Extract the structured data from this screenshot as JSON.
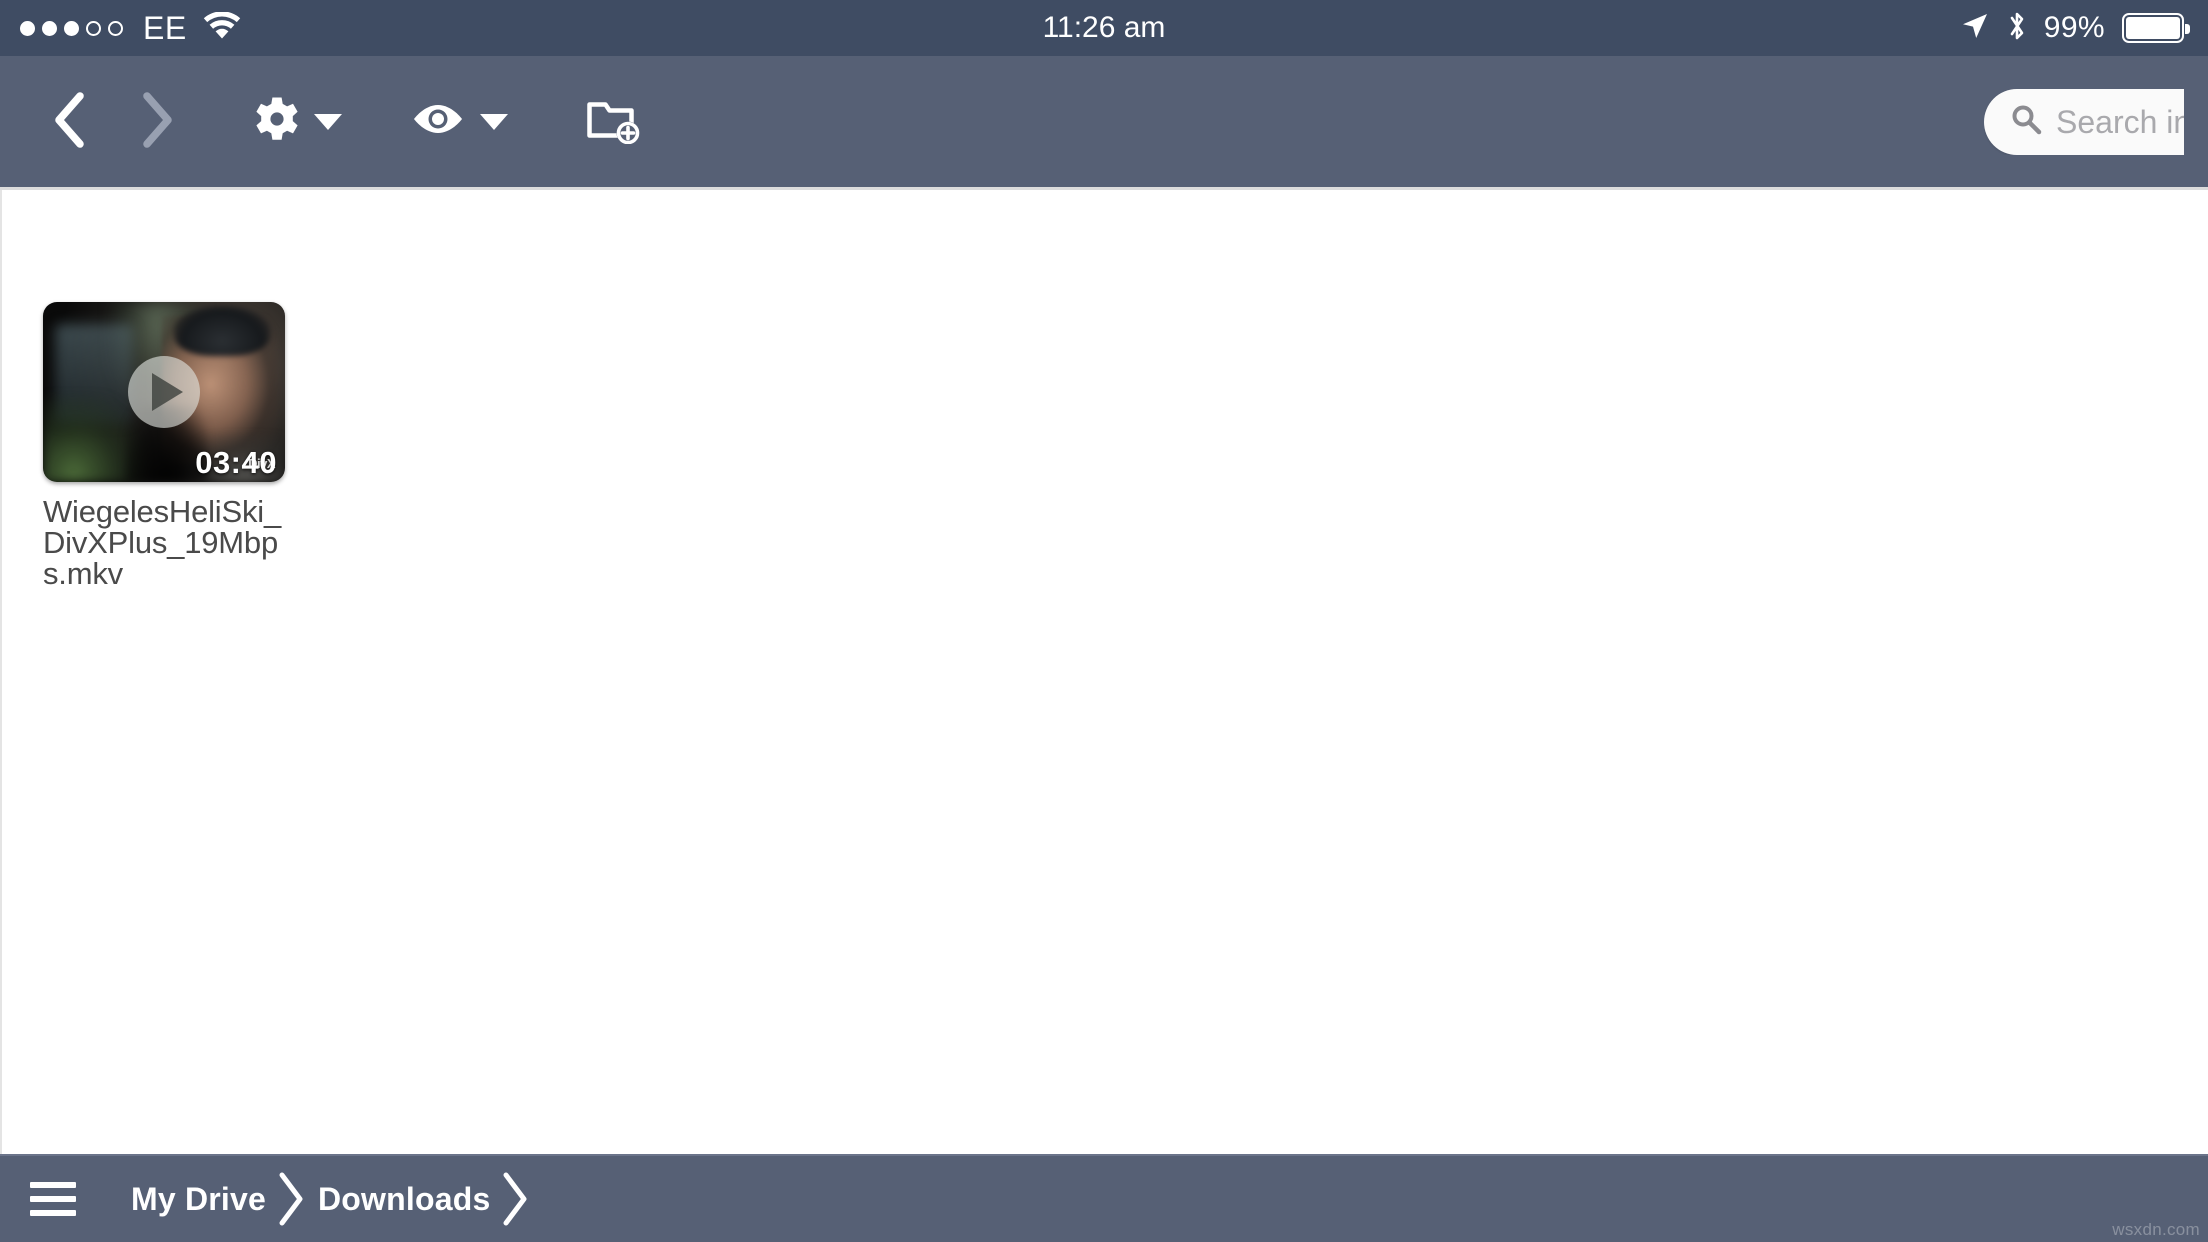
{
  "status_bar": {
    "signal_dots_filled": 3,
    "signal_dots_total": 5,
    "carrier": "EE",
    "wifi_icon": "wifi-icon",
    "time": "11:26 am",
    "location_icon": "location-arrow-icon",
    "bluetooth_icon": "bluetooth-icon",
    "battery_percent": "99%",
    "battery_level": 99,
    "bg_color": "#3f4c63",
    "fg_color": "#ffffff"
  },
  "toolbar": {
    "bg_color": "#566075",
    "back_label": "Back",
    "back_icon": "chevron-left-icon",
    "back_enabled": true,
    "forward_label": "Forward",
    "forward_icon": "chevron-right-icon",
    "forward_enabled": false,
    "settings_icon": "gear-icon",
    "settings_caret_icon": "caret-down-icon",
    "view_icon": "eye-icon",
    "view_caret_icon": "caret-down-icon",
    "new_folder_icon": "folder-plus-icon",
    "search": {
      "icon": "search-icon",
      "placeholder": "Search in...",
      "value": ""
    }
  },
  "content": {
    "bg_color": "#ffffff",
    "files": [
      {
        "name": "WiegelesHeliSki_DivXPlus_19Mbps.mkv",
        "type": "video",
        "duration": "03:40",
        "play_icon": "play-button-icon",
        "format_badge": "DivX"
      }
    ]
  },
  "breadcrumb_bar": {
    "bg_color": "#566075",
    "menu_icon": "hamburger-menu-icon",
    "separator_icon": "chevron-right-icon",
    "crumbs": [
      {
        "label": "My Drive"
      },
      {
        "label": "Downloads"
      }
    ]
  },
  "watermark": {
    "text": "wsxdn.com"
  }
}
